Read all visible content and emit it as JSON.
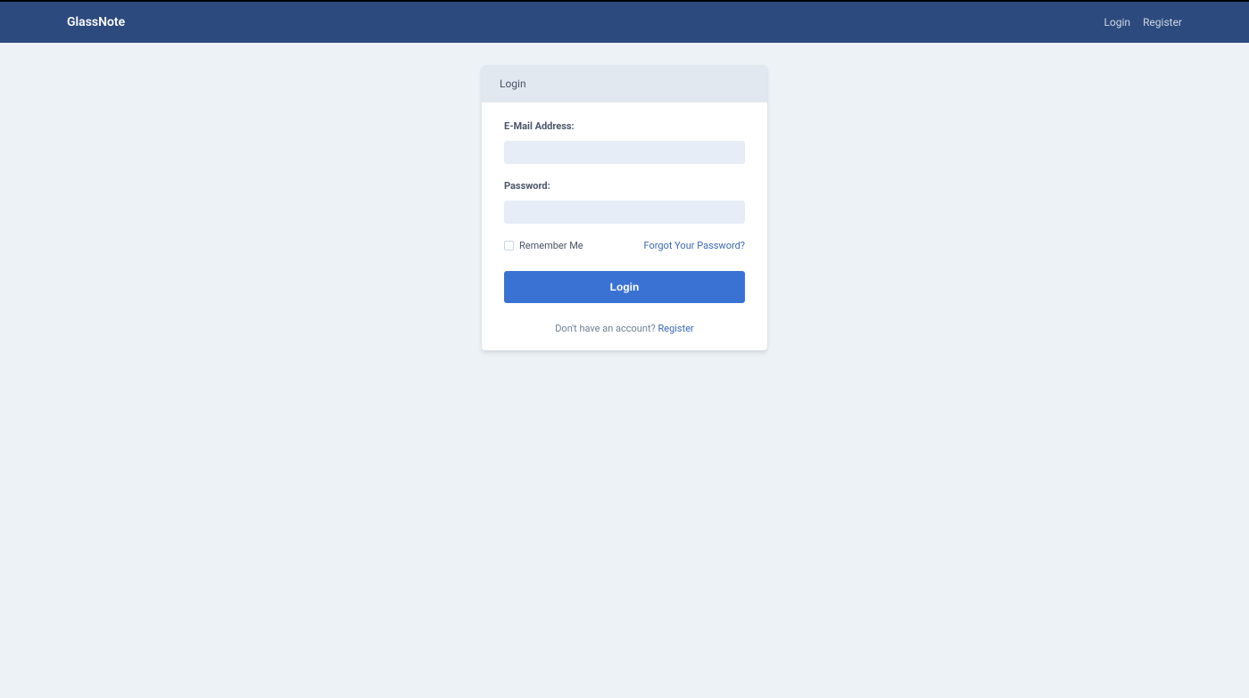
{
  "navbar": {
    "brand": "GlassNote",
    "login_link": "Login",
    "register_link": "Register"
  },
  "card": {
    "header": "Login",
    "email_label": "E-Mail Address:",
    "password_label": "Password:",
    "remember_label": "Remember Me",
    "forgot_link": "Forgot Your Password?",
    "login_button": "Login",
    "no_account_text": "Don't have an account? ",
    "register_link": "Register",
    "email_value": "",
    "password_value": ""
  }
}
